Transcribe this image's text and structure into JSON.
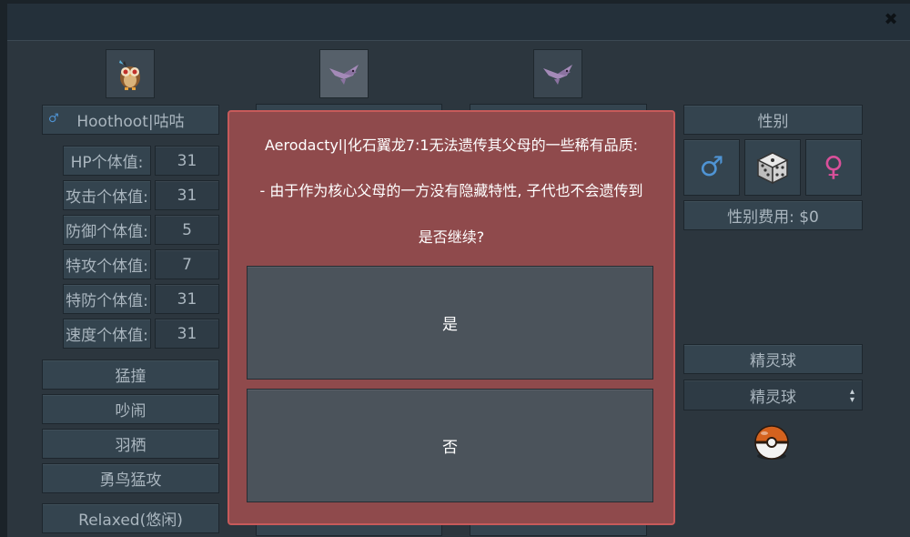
{
  "window": {
    "close_glyph": "✖"
  },
  "parents": {
    "slot1_sprite": "owl-pokemon-icon",
    "slot2_sprite": "pterodactyl-pokemon-icon",
    "slot3_sprite": "pterodactyl-pokemon-icon"
  },
  "left_panel": {
    "pokemon_name": "Hoothoot|咕咕",
    "gender_symbol": "♂",
    "iv_rows": [
      {
        "label": "HP个体值:",
        "value": "31"
      },
      {
        "label": "攻击个体值:",
        "value": "31"
      },
      {
        "label": "防御个体值:",
        "value": "5"
      },
      {
        "label": "特攻个体值:",
        "value": "7"
      },
      {
        "label": "特防个体值:",
        "value": "31"
      },
      {
        "label": "速度个体值:",
        "value": "31"
      }
    ],
    "moves": [
      "猛撞",
      "吵闹",
      "羽栖",
      "勇鸟猛攻"
    ],
    "nature": "Relaxed(悠闲)"
  },
  "right_panel": {
    "gender_header": "性别",
    "male_symbol": "♂",
    "female_symbol": "♀",
    "gender_cost": "性别费用: $0",
    "ball_header": "精灵球",
    "ball_select_value": "精灵球",
    "ball_icon": "poke-ball-icon"
  },
  "dialog": {
    "line1": "Aerodactyl|化石翼龙7:1无法遗传其父母的一些稀有品质:",
    "line2": "- 由于作为核心父母的一方没有隐藏特性, 子代也不会遗传到",
    "line3": "是否继续?",
    "yes_label": "是",
    "no_label": "否"
  },
  "colors": {
    "male": "#4f94d4",
    "female": "#d9509a",
    "dialog_bg": "#8f4a4c",
    "dialog_border": "#c75a5a"
  }
}
